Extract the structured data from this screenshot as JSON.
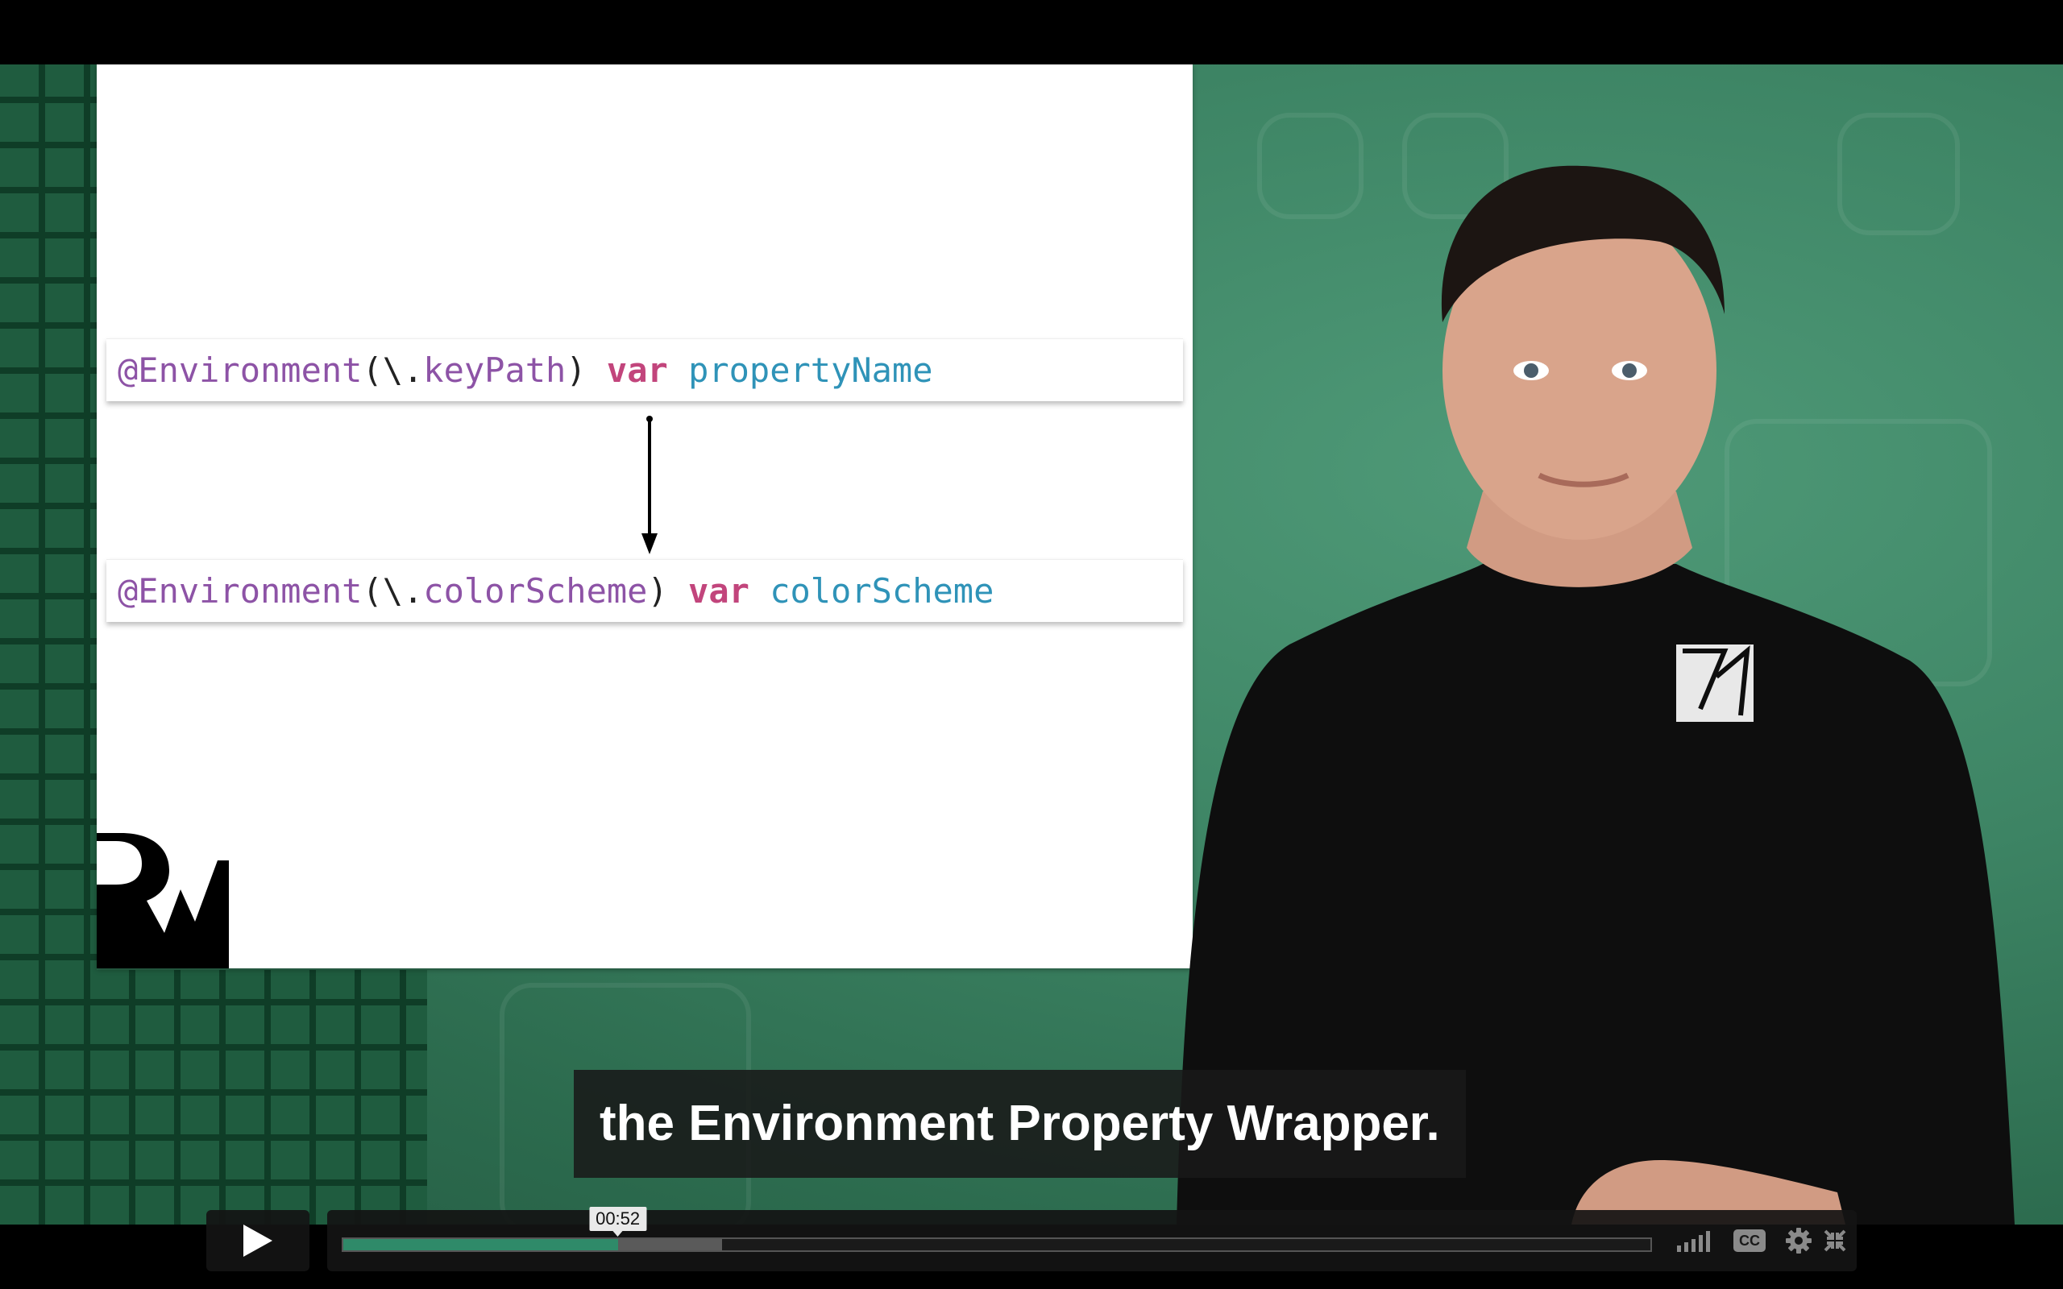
{
  "slide": {
    "code_line_1": {
      "attr": "@Environment",
      "open": "(\\.",
      "path": "keyPath",
      "close": ")",
      "kw": "var",
      "name": "propertyName"
    },
    "code_line_2": {
      "attr": "@Environment",
      "open": "(\\.",
      "path": "colorScheme",
      "close": ")",
      "kw": "var",
      "name": "colorScheme"
    }
  },
  "caption": {
    "text": "the Environment Property Wrapper."
  },
  "player": {
    "current_time": "00:52",
    "played_fraction": 0.21,
    "loaded_fraction": 0.29,
    "cc_label": "CC"
  },
  "colors": {
    "accent": "#2f8a69",
    "code_attr": "#8d53a6",
    "code_keyword": "#c2457c",
    "code_name": "#2f93b8"
  },
  "icons": [
    "play-icon",
    "volume-icon",
    "closed-captions-icon",
    "gear-icon",
    "exit-fullscreen-icon"
  ]
}
